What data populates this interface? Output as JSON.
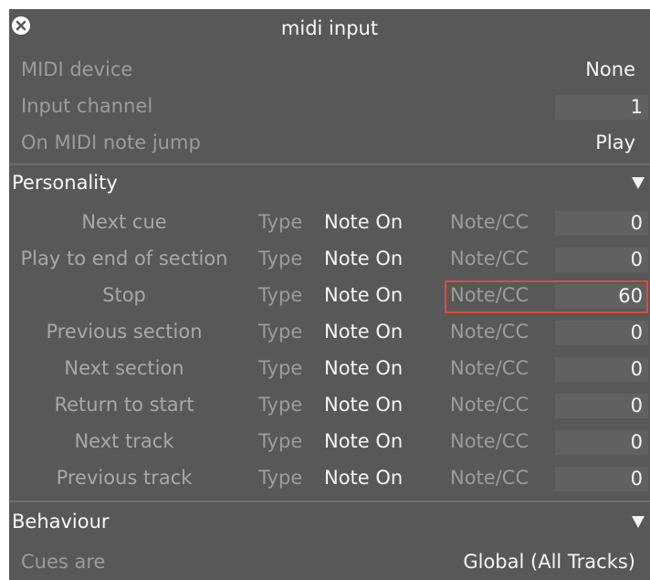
{
  "title": "midi input",
  "header": {
    "midi_device_label": "MIDI device",
    "midi_device_value": "None",
    "input_channel_label": "Input channel",
    "input_channel_value": "1",
    "note_jump_label": "On MIDI note jump",
    "note_jump_value": "Play"
  },
  "personality": {
    "title": "Personality",
    "rows": [
      {
        "action": "Next cue",
        "type_label": "Type",
        "type_value": "Note On",
        "cc_label": "Note/CC",
        "cc_value": "0"
      },
      {
        "action": "Play to end of section",
        "type_label": "Type",
        "type_value": "Note On",
        "cc_label": "Note/CC",
        "cc_value": "0"
      },
      {
        "action": "Stop",
        "type_label": "Type",
        "type_value": "Note On",
        "cc_label": "Note/CC",
        "cc_value": "60"
      },
      {
        "action": "Previous section",
        "type_label": "Type",
        "type_value": "Note On",
        "cc_label": "Note/CC",
        "cc_value": "0"
      },
      {
        "action": "Next section",
        "type_label": "Type",
        "type_value": "Note On",
        "cc_label": "Note/CC",
        "cc_value": "0"
      },
      {
        "action": "Return to start",
        "type_label": "Type",
        "type_value": "Note On",
        "cc_label": "Note/CC",
        "cc_value": "0"
      },
      {
        "action": "Next track",
        "type_label": "Type",
        "type_value": "Note On",
        "cc_label": "Note/CC",
        "cc_value": "0"
      },
      {
        "action": "Previous track",
        "type_label": "Type",
        "type_value": "Note On",
        "cc_label": "Note/CC",
        "cc_value": "0"
      }
    ]
  },
  "behaviour": {
    "title": "Behaviour",
    "cues_are_label": "Cues are",
    "cues_are_value": "Global (All Tracks)"
  },
  "colors": {
    "panel_bg": "#585858",
    "dim_text": "#9c9c9c",
    "highlight_border": "#e04a3b"
  },
  "icons": {
    "close": "close-circle-icon",
    "collapse": "triangle-down-icon"
  }
}
